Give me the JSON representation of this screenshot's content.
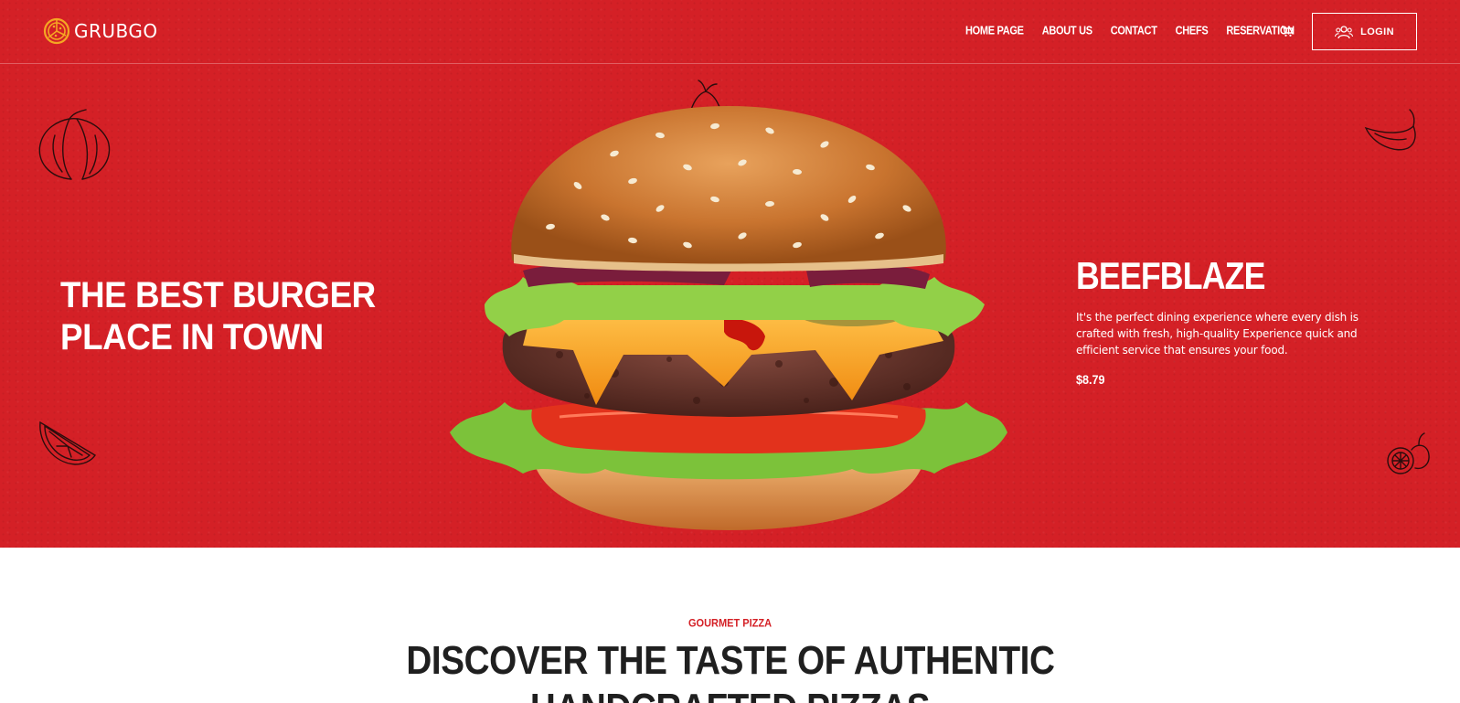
{
  "brand": {
    "name": "GRUBGO",
    "accent_color": "#f5a623",
    "hero_color": "#d42026"
  },
  "nav": {
    "items": [
      {
        "label": "HOME PAGE"
      },
      {
        "label": "ABOUT US"
      },
      {
        "label": "CONTACT"
      },
      {
        "label": "CHEFS"
      },
      {
        "label": "RESERVATION"
      }
    ],
    "cart_icon": "cart-icon",
    "login": {
      "label": "LOGIN",
      "icon": "users-icon"
    }
  },
  "hero": {
    "heading_line1": "THE BEST BURGER",
    "heading_line2": "PLACE IN TOWN",
    "product": {
      "name": "BEEFBLAZE",
      "description": "It's the perfect dining experience where every dish is crafted with fresh, high-quality Experience quick and efficient service that ensures your food.",
      "price": "$8.79"
    }
  },
  "section": {
    "eyebrow": "GOURMET PIZZA",
    "title_line1": "DISCOVER THE TASTE OF AUTHENTIC",
    "title_line2": "HANDCRAFTED PIZZAS"
  }
}
